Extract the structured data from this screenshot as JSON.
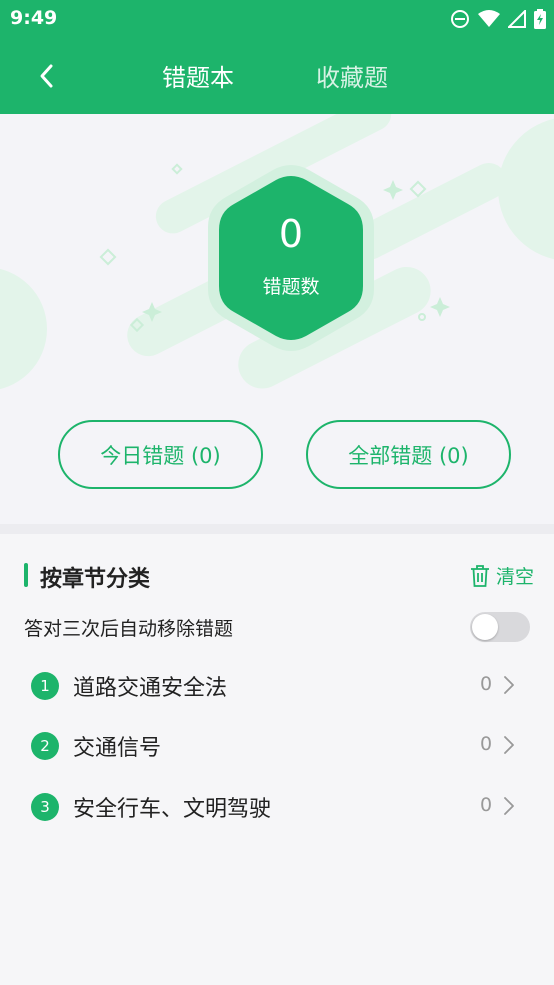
{
  "status_bar": {
    "time": "9:49",
    "icons": [
      "do-not-disturb-icon",
      "wifi-icon",
      "signal-icon",
      "battery-charging-icon"
    ]
  },
  "header": {
    "back_icon": "chevron-left-icon",
    "tabs": [
      {
        "label": "错题本",
        "active": true
      },
      {
        "label": "收藏题",
        "active": false
      }
    ]
  },
  "summary": {
    "count": "0",
    "count_label": "错题数",
    "today_button": "今日错题 (0)",
    "all_button": "全部错题 (0)"
  },
  "chapters": {
    "title": "按章节分类",
    "clear_label": "清空",
    "clear_icon": "trash-icon",
    "auto_remove_label": "答对三次后自动移除错题",
    "auto_remove_enabled": false,
    "items": [
      {
        "index": "1",
        "name": "道路交通安全法",
        "count": "0"
      },
      {
        "index": "2",
        "name": "交通信号",
        "count": "0"
      },
      {
        "index": "3",
        "name": "安全行车、文明驾驶",
        "count": "0"
      }
    ]
  },
  "colors": {
    "accent": "#1db46b",
    "background": "#f6f6f8",
    "text": "#222222",
    "muted": "#999999"
  }
}
